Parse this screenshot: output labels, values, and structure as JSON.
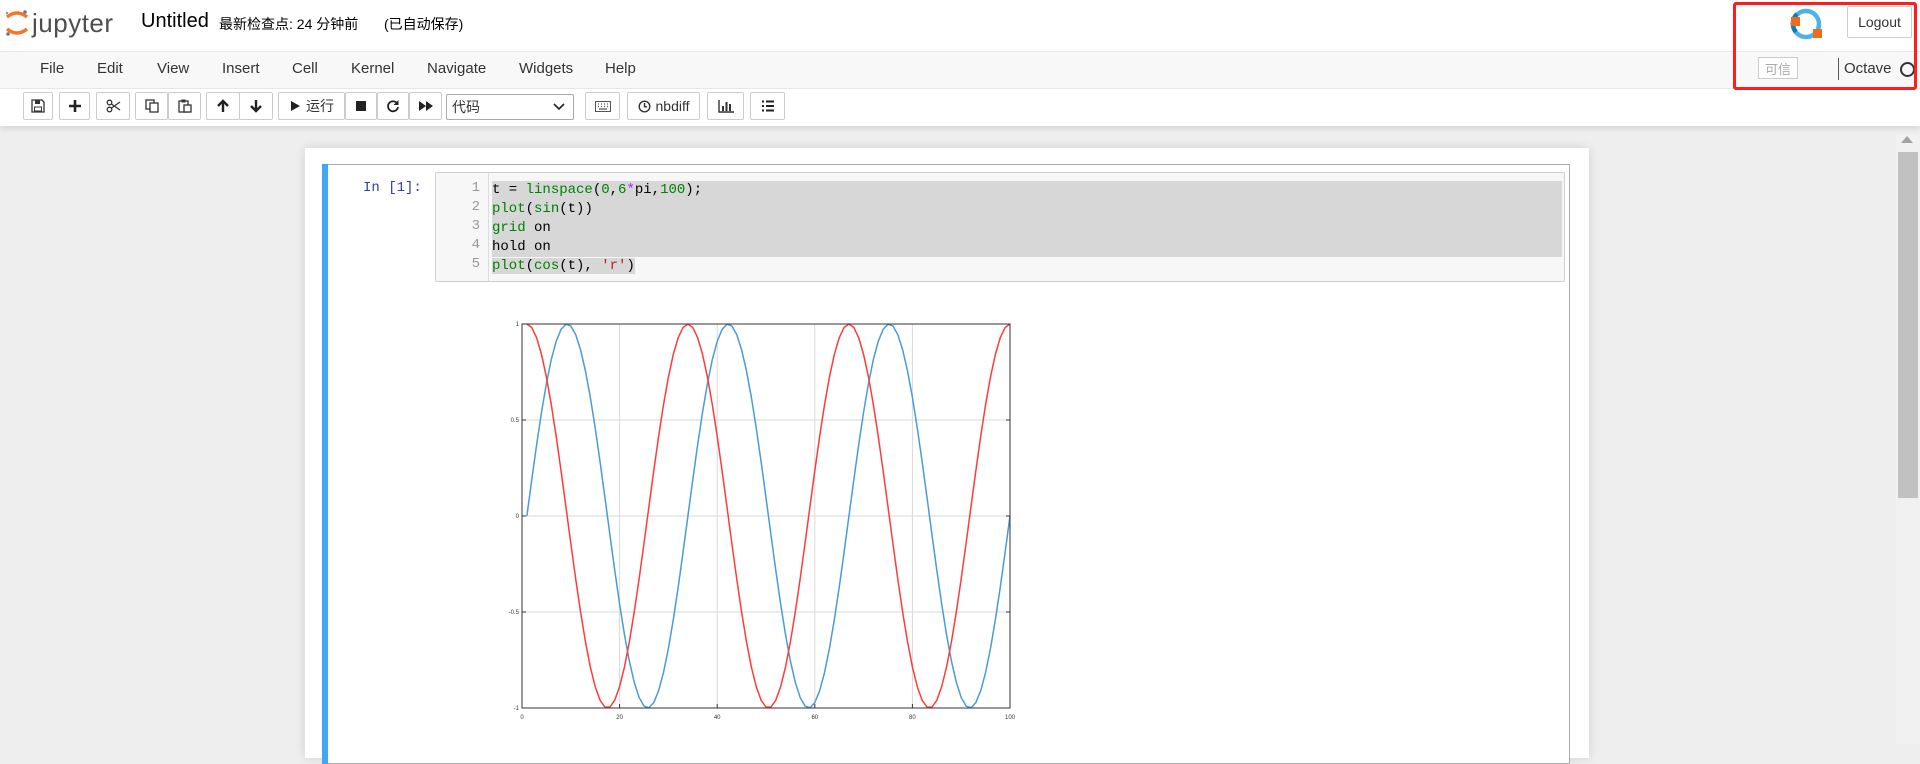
{
  "header": {
    "logo_text": "jupyter",
    "notebook_name": "Untitled",
    "checkpoint": "最新检查点: 24 分钟前",
    "autosave": "(已自动保存)",
    "logout_label": "Logout"
  },
  "menubar": {
    "items": [
      "File",
      "Edit",
      "View",
      "Insert",
      "Cell",
      "Kernel",
      "Navigate",
      "Widgets",
      "Help"
    ],
    "trusted_label": "可信",
    "kernel_name": "Octave"
  },
  "toolbar": {
    "run_label": "运行",
    "cell_type": "代码",
    "nbdiff_label": "nbdiff"
  },
  "cell": {
    "prompt": "In  [1]:",
    "line_numbers": [
      "1",
      "2",
      "3",
      "4",
      "5"
    ]
  },
  "chart_data": {
    "type": "line",
    "title": "",
    "xlabel": "",
    "ylabel": "",
    "xlim": [
      0,
      100
    ],
    "ylim": [
      -1,
      1
    ],
    "grid": true,
    "x_ticks": [
      "0",
      "20",
      "40",
      "60",
      "80",
      "100"
    ],
    "y_ticks": [
      "1",
      "0.5",
      "0",
      "-0.5",
      "-1"
    ],
    "series": [
      {
        "formula": "sin(6*pi*(i-1)/99)",
        "points": 100,
        "color": "#4a9bd6"
      },
      {
        "formula": "cos(6*pi*(i-1)/99)",
        "points": 100,
        "color": "#ff3b3b"
      }
    ]
  },
  "colors": {
    "accent": "#42a5f5",
    "highlight": "#ff1e1e"
  }
}
